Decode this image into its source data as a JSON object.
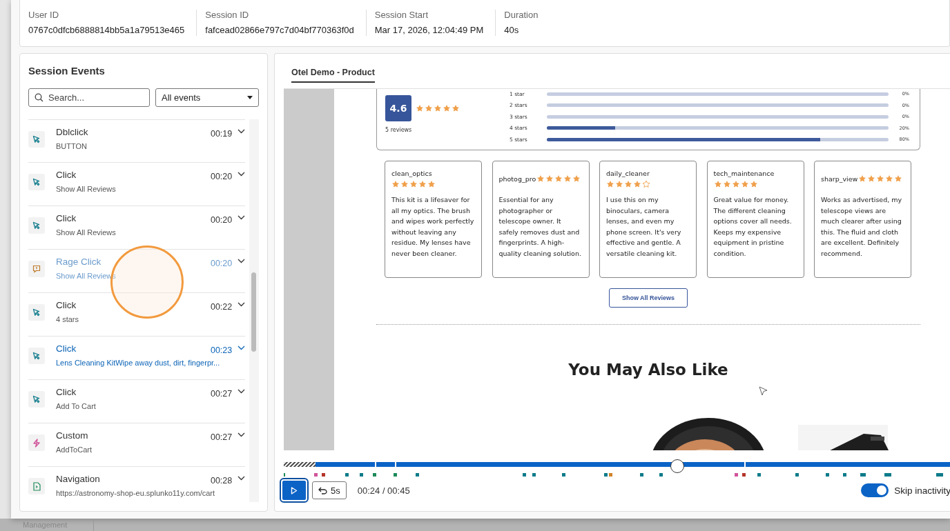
{
  "session_info": [
    {
      "label": "User ID",
      "value": "0767c0dfcb6888814bb5a1a79513e465"
    },
    {
      "label": "Session ID",
      "value": "fafcead02866e797c7d04bf770363f0d"
    },
    {
      "label": "Session Start",
      "value": "Mar 17, 2026, 12:04:49 PM"
    },
    {
      "label": "Duration",
      "value": "40s"
    }
  ],
  "events_panel": {
    "title": "Session Events",
    "search": {
      "placeholder": "Search..."
    },
    "filter": {
      "value": "All events"
    },
    "events": [
      {
        "kind": "click",
        "title": "Dblclick",
        "detail": "BUTTON",
        "time": "00:19",
        "selected": false,
        "hovered": false
      },
      {
        "kind": "click",
        "title": "Click",
        "detail": "Show All Reviews",
        "time": "00:20",
        "selected": false,
        "hovered": false
      },
      {
        "kind": "click",
        "title": "Click",
        "detail": "Show All Reviews",
        "time": "00:20",
        "selected": false,
        "hovered": false
      },
      {
        "kind": "rage",
        "title": "Rage Click",
        "detail": "Show All Reviews",
        "time": "00:20",
        "selected": false,
        "hovered": true
      },
      {
        "kind": "click",
        "title": "Click",
        "detail": "4 stars",
        "time": "00:22",
        "selected": false,
        "hovered": false
      },
      {
        "kind": "click",
        "title": "Click",
        "detail": "Lens Cleaning KitWipe away dust, dirt, fingerpr...",
        "time": "00:23",
        "selected": true,
        "hovered": false
      },
      {
        "kind": "click",
        "title": "Click",
        "detail": "Add To Cart",
        "time": "00:27",
        "selected": false,
        "hovered": false
      },
      {
        "kind": "custom",
        "title": "Custom",
        "detail": "AddToCart",
        "time": "00:27",
        "selected": false,
        "hovered": false
      },
      {
        "kind": "navigation",
        "title": "Navigation",
        "detail": "https://astronomy-shop-eu.splunko11y.com/cart",
        "time": "00:28",
        "selected": false,
        "hovered": false
      }
    ]
  },
  "replay": {
    "tabs": [
      {
        "label": "Otel Demo - Product",
        "selected": true
      }
    ],
    "rating": {
      "score": "4.6",
      "stars": 5,
      "count": "5 reviews",
      "bars": [
        {
          "label": "1 star",
          "level": 0,
          "percent": "0%"
        },
        {
          "label": "2 stars",
          "level": 0,
          "percent": "0%"
        },
        {
          "label": "3 stars",
          "level": 0,
          "percent": "0%"
        },
        {
          "label": "4 stars",
          "level": 0.2,
          "percent": "20%"
        },
        {
          "label": "5 stars",
          "level": 0.8,
          "percent": "80%"
        }
      ]
    },
    "reviews": [
      {
        "user": "clean_optics",
        "stars": 5,
        "text": "This kit is a lifesaver for all my optics. The brush and wipes work perfectly without leaving any residue. My lenses have never been cleaner."
      },
      {
        "user": "photog_pro",
        "stars": 5,
        "text": "Essential for any photographer or telescope owner. It safely removes dust and fingerprints. A high-quality cleaning solution."
      },
      {
        "user": "daily_cleaner",
        "stars": 4,
        "text": "I use this on my binoculars, camera lenses, and even my phone screen. It's very effective and gentle. A versatile cleaning kit."
      },
      {
        "user": "tech_maintenance",
        "stars": 5,
        "text": "Great value for money. The different cleaning options cover all needs. Keeps my expensive equipment in pristine condition."
      },
      {
        "user": "sharp_view",
        "stars": 5,
        "text": "Works as advertised, my telescope views are much clearer after using this. The fluid and cloth are excellent. Definitely recommend."
      }
    ],
    "show_all_button": "Show All Reviews",
    "section_heading": "You May Also Like"
  },
  "player": {
    "level": 0.59,
    "back_button": "5s",
    "time": "00:24 / 00:45",
    "skip_inactivity": {
      "label": "Skip inactivity",
      "on": true
    }
  },
  "background": {
    "nav_label": "Management"
  }
}
